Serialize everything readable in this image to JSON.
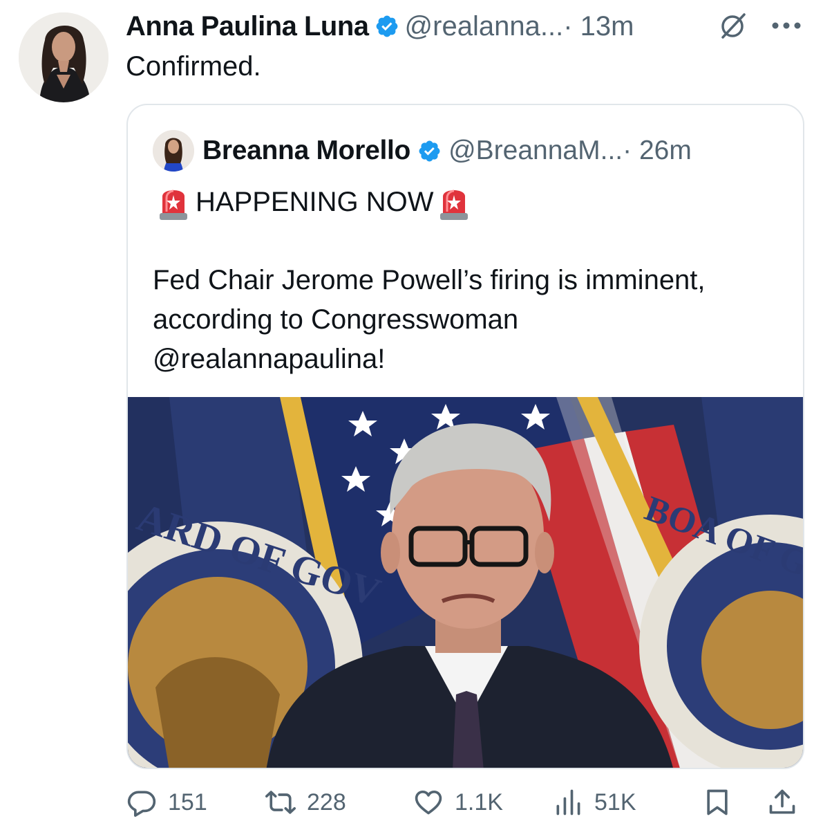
{
  "tweet": {
    "author_name": "Anna Paulina Luna",
    "handle": "@realanna...",
    "time": "· 13m",
    "text": "Confirmed."
  },
  "quoted_tweet": {
    "author_name": "Breanna Morello",
    "handle": "@BreannaM...",
    "time": "· 26m",
    "headline": "HAPPENING NOW",
    "body_line1": "Fed Chair Jerome Powell’s firing is imminent,",
    "body_line2": "according to Congresswoman",
    "body_line3": "@realannapaulina!",
    "photo_seal_left": "ARD OF GOV",
    "photo_seal_right": "BOA OF GOVE"
  },
  "metrics": {
    "replies": "151",
    "reposts": "228",
    "likes": "1.1K",
    "views": "51K"
  },
  "colors": {
    "verified": "#1d9bf0",
    "muted": "#536471",
    "border": "#e1e6ea"
  },
  "icons": [
    "verified-badge-icon",
    "grok-icon",
    "more-icon",
    "siren-icon",
    "reply-icon",
    "retweet-icon",
    "like-icon",
    "views-icon",
    "bookmark-icon",
    "share-icon"
  ]
}
